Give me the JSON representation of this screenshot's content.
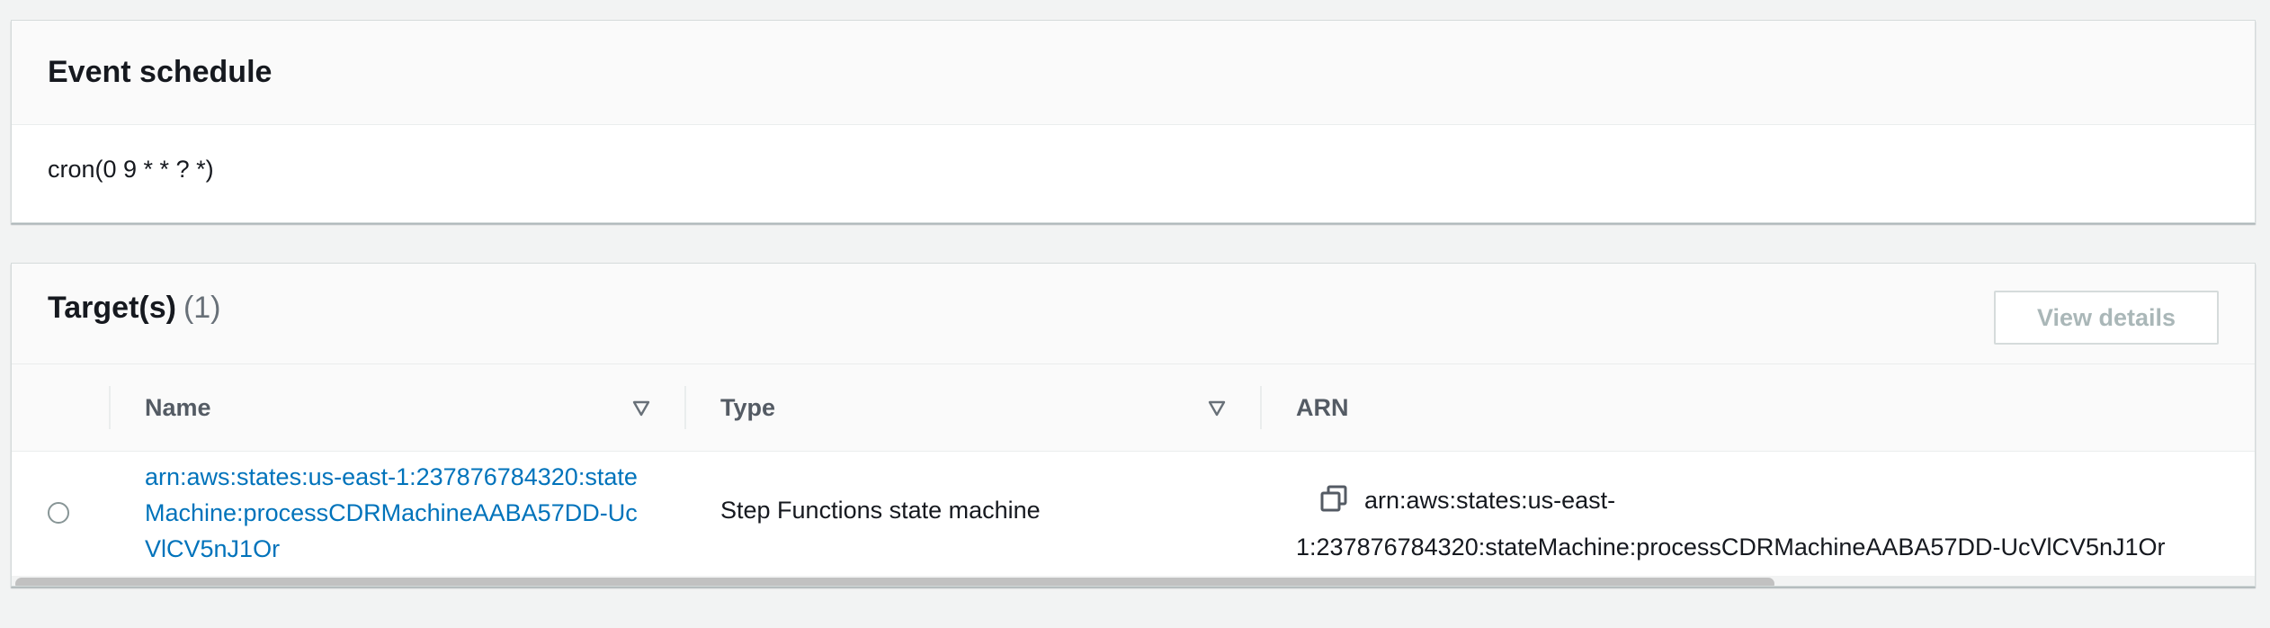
{
  "event_schedule": {
    "title": "Event schedule",
    "value": "cron(0 9 * * ? *)"
  },
  "targets": {
    "title": "Target(s)",
    "count": "(1)",
    "view_details_label": "View details",
    "columns": {
      "name": "Name",
      "type": "Type",
      "arn": "ARN"
    },
    "rows": [
      {
        "name": "arn:aws:states:us-east-1:237876784320:stateMachine:processCDRMachineAABA57DD-UcVlCV5nJ1Or",
        "type": "Step Functions state machine",
        "arn": "arn:aws:states:us-east-1:237876784320:stateMachine:processCDRMachineAABA57DD-UcVlCV5nJ1Or"
      }
    ]
  },
  "icons": {
    "sort": "caret-down-outline-icon",
    "copy": "copy-icon",
    "radio": "radio-unselected"
  },
  "colors": {
    "link": "#0073bb",
    "background": "#f2f3f3",
    "muted_text": "#687078",
    "header_text": "#545b64"
  }
}
